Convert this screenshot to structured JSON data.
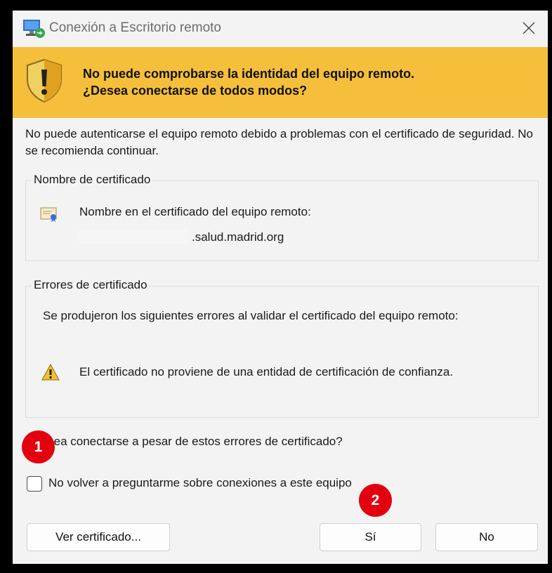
{
  "window": {
    "title": "Conexión a Escritorio remoto",
    "close_glyph": "✕"
  },
  "banner": {
    "line1": "No puede comprobarse la identidad del equipo remoto.",
    "line2": "¿Desea conectarse de todos modos?",
    "color": "#f5bf3c",
    "icon": "shield-warning-icon"
  },
  "body_text": "No puede autenticarse el equipo remoto debido a problemas con el certificado de seguridad. No se recomienda continuar.",
  "cert_group": {
    "legend": "Nombre de certificado",
    "label": "Nombre en el certificado del equipo remoto:",
    "value": ".salud.madrid.org",
    "icon": "certificate-icon"
  },
  "errors_group": {
    "legend": "Errores de certificado",
    "intro": "Se produjeron los siguientes errores al validar el certificado del equipo remoto:",
    "error": "El certificado no proviene de una entidad de certificación de confianza.",
    "icon": "warning-icon"
  },
  "question": "¿Desea conectarse a pesar de estos errores de certificado?",
  "checkbox": {
    "label": "No volver a preguntarme sobre conexiones a este equipo",
    "checked": false
  },
  "buttons": {
    "view_cert": "Ver certificado...",
    "yes": "Sí",
    "no": "No"
  },
  "markers": {
    "one": "1",
    "two": "2",
    "color": "#e3000f"
  }
}
